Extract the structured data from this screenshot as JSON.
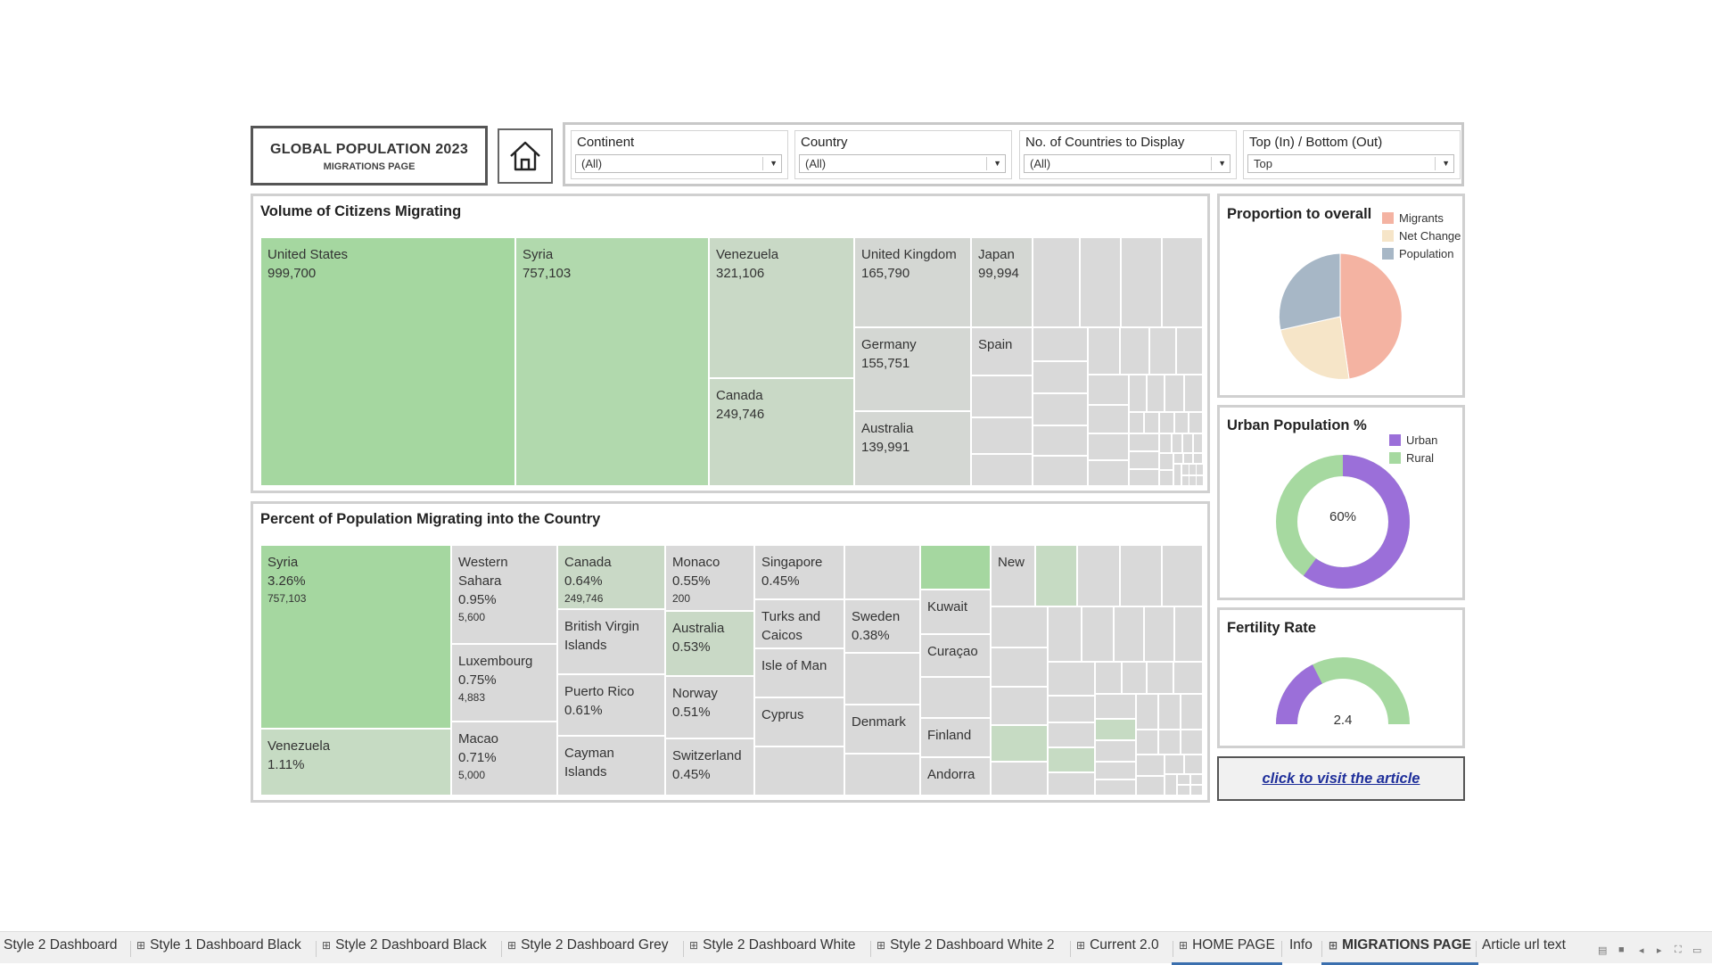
{
  "header": {
    "title": "GLOBAL POPULATION 2023",
    "subtitle": "MIGRATIONS PAGE"
  },
  "filters": [
    {
      "label": "Continent",
      "value": "(All)"
    },
    {
      "label": "Country",
      "value": "(All)"
    },
    {
      "label": "No. of Countries to Display",
      "value": "(All)"
    },
    {
      "label": "Top (In) / Bottom (Out)",
      "value": "Top"
    }
  ],
  "volume_panel": {
    "title": "Volume of Citizens Migrating",
    "tiles": [
      {
        "name": "United States",
        "value": "999,700"
      },
      {
        "name": "Syria",
        "value": "757,103"
      },
      {
        "name": "Venezuela",
        "value": "321,106"
      },
      {
        "name": "Canada",
        "value": "249,746"
      },
      {
        "name": "United Kingdom",
        "value": "165,790"
      },
      {
        "name": "Germany",
        "value": "155,751"
      },
      {
        "name": "Australia",
        "value": "139,991"
      },
      {
        "name": "Japan",
        "value": "99,994"
      },
      {
        "name": "Spain",
        "value": ""
      }
    ]
  },
  "percent_panel": {
    "title": "Percent of Population Migrating into the Country",
    "tiles": [
      {
        "name": "Syria",
        "pct": "3.26%",
        "value": "757,103"
      },
      {
        "name": "Venezuela",
        "pct": "1.11%",
        "value": ""
      },
      {
        "name": "Western Sahara",
        "pct": "0.95%",
        "value": "5,600"
      },
      {
        "name": "Luxembourg",
        "pct": "0.75%",
        "value": "4,883"
      },
      {
        "name": "Macao",
        "pct": "0.71%",
        "value": "5,000"
      },
      {
        "name": "Canada",
        "pct": "0.64%",
        "value": "249,746"
      },
      {
        "name": "British Virgin Islands",
        "pct": "",
        "value": ""
      },
      {
        "name": "Puerto Rico",
        "pct": "0.61%",
        "value": ""
      },
      {
        "name": "Cayman Islands",
        "pct": "",
        "value": ""
      },
      {
        "name": "Monaco",
        "pct": "0.55%",
        "value": "200"
      },
      {
        "name": "Australia",
        "pct": "0.53%",
        "value": ""
      },
      {
        "name": "Norway",
        "pct": "0.51%",
        "value": ""
      },
      {
        "name": "Switzerland",
        "pct": "0.45%",
        "value": ""
      },
      {
        "name": "Singapore",
        "pct": "0.45%",
        "value": ""
      },
      {
        "name": "Turks and Caicos",
        "pct": "",
        "value": ""
      },
      {
        "name": "Isle of Man",
        "pct": "",
        "value": ""
      },
      {
        "name": "Cyprus",
        "pct": "",
        "value": ""
      },
      {
        "name": "Sweden",
        "pct": "0.38%",
        "value": ""
      },
      {
        "name": "Denmark",
        "pct": "",
        "value": ""
      },
      {
        "name": "Kuwait",
        "pct": "",
        "value": ""
      },
      {
        "name": "Curaçao",
        "pct": "",
        "value": ""
      },
      {
        "name": "Finland",
        "pct": "",
        "value": ""
      },
      {
        "name": "Andorra",
        "pct": "",
        "value": ""
      },
      {
        "name": "New",
        "pct": "",
        "value": ""
      }
    ]
  },
  "proportion_panel": {
    "title": "Proportion to overall",
    "legend": [
      {
        "label": "Migrants",
        "color": "#f4b3a2"
      },
      {
        "label": "Net Change",
        "color": "#f6e5c8"
      },
      {
        "label": "Population",
        "color": "#a7b7c6"
      }
    ]
  },
  "urban_panel": {
    "title": "Urban Population %",
    "center_label": "60%",
    "value": 60,
    "legend": [
      {
        "label": "Urban",
        "color": "#9b6fd9"
      },
      {
        "label": "Rural",
        "color": "#a6d9a0"
      }
    ]
  },
  "fertility_panel": {
    "title": "Fertility Rate",
    "value_label": "2.4",
    "fill_fraction": 0.35
  },
  "article_link": "click to visit the article",
  "tabs": [
    {
      "label": "Style 2 Dashboard",
      "icon": false
    },
    {
      "label": "Style 1 Dashboard Black",
      "icon": true
    },
    {
      "label": "Style 2 Dashboard Black",
      "icon": true
    },
    {
      "label": "Style 2 Dashboard Grey",
      "icon": true
    },
    {
      "label": "Style 2 Dashboard White",
      "icon": true
    },
    {
      "label": "Style 2 Dashboard White 2",
      "icon": true
    },
    {
      "label": "Current 2.0",
      "icon": true
    },
    {
      "label": "HOME PAGE",
      "icon": true
    },
    {
      "label": "Info",
      "icon": false
    },
    {
      "label": "MIGRATIONS PAGE",
      "icon": true,
      "active": true
    },
    {
      "label": "Article url text",
      "icon": false
    }
  ],
  "icons": {
    "home": "home-icon",
    "dropdown": "chevron-down-icon",
    "dashboard_tab": "dashboard-grid-icon"
  }
}
